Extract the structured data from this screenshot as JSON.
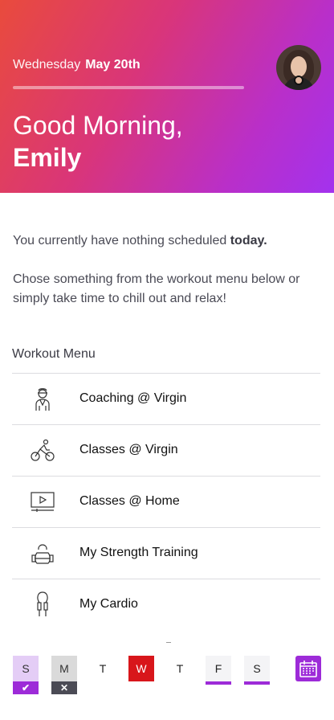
{
  "header": {
    "weekday": "Wednesday",
    "month_day": "May 20th",
    "greeting": "Good Morning,",
    "name": "Emily",
    "progress_fraction": 1.0
  },
  "message": {
    "line1_prefix": "You currently have nothing scheduled ",
    "line1_bold": "today.",
    "line2": "Chose something from the workout menu below or simply take time to chill out and relax!"
  },
  "menu": {
    "title": "Workout Menu",
    "items": [
      {
        "label": "Coaching @ Virgin",
        "icon": "coach-icon"
      },
      {
        "label": "Classes @ Virgin",
        "icon": "cycling-icon"
      },
      {
        "label": "Classes @ Home",
        "icon": "video-player-icon"
      },
      {
        "label": "My Strength Training",
        "icon": "kettlebell-icon"
      },
      {
        "label": "My Cardio",
        "icon": "jump-rope-icon"
      }
    ]
  },
  "week": {
    "days": [
      "S",
      "M",
      "T",
      "W",
      "T",
      "F",
      "S"
    ],
    "done_mark": "✔",
    "missed_mark": "✕"
  },
  "colors": {
    "accent": "#9d2bd8",
    "today": "#d8161b",
    "header_start": "#e94b3c",
    "header_end": "#a332ee"
  }
}
